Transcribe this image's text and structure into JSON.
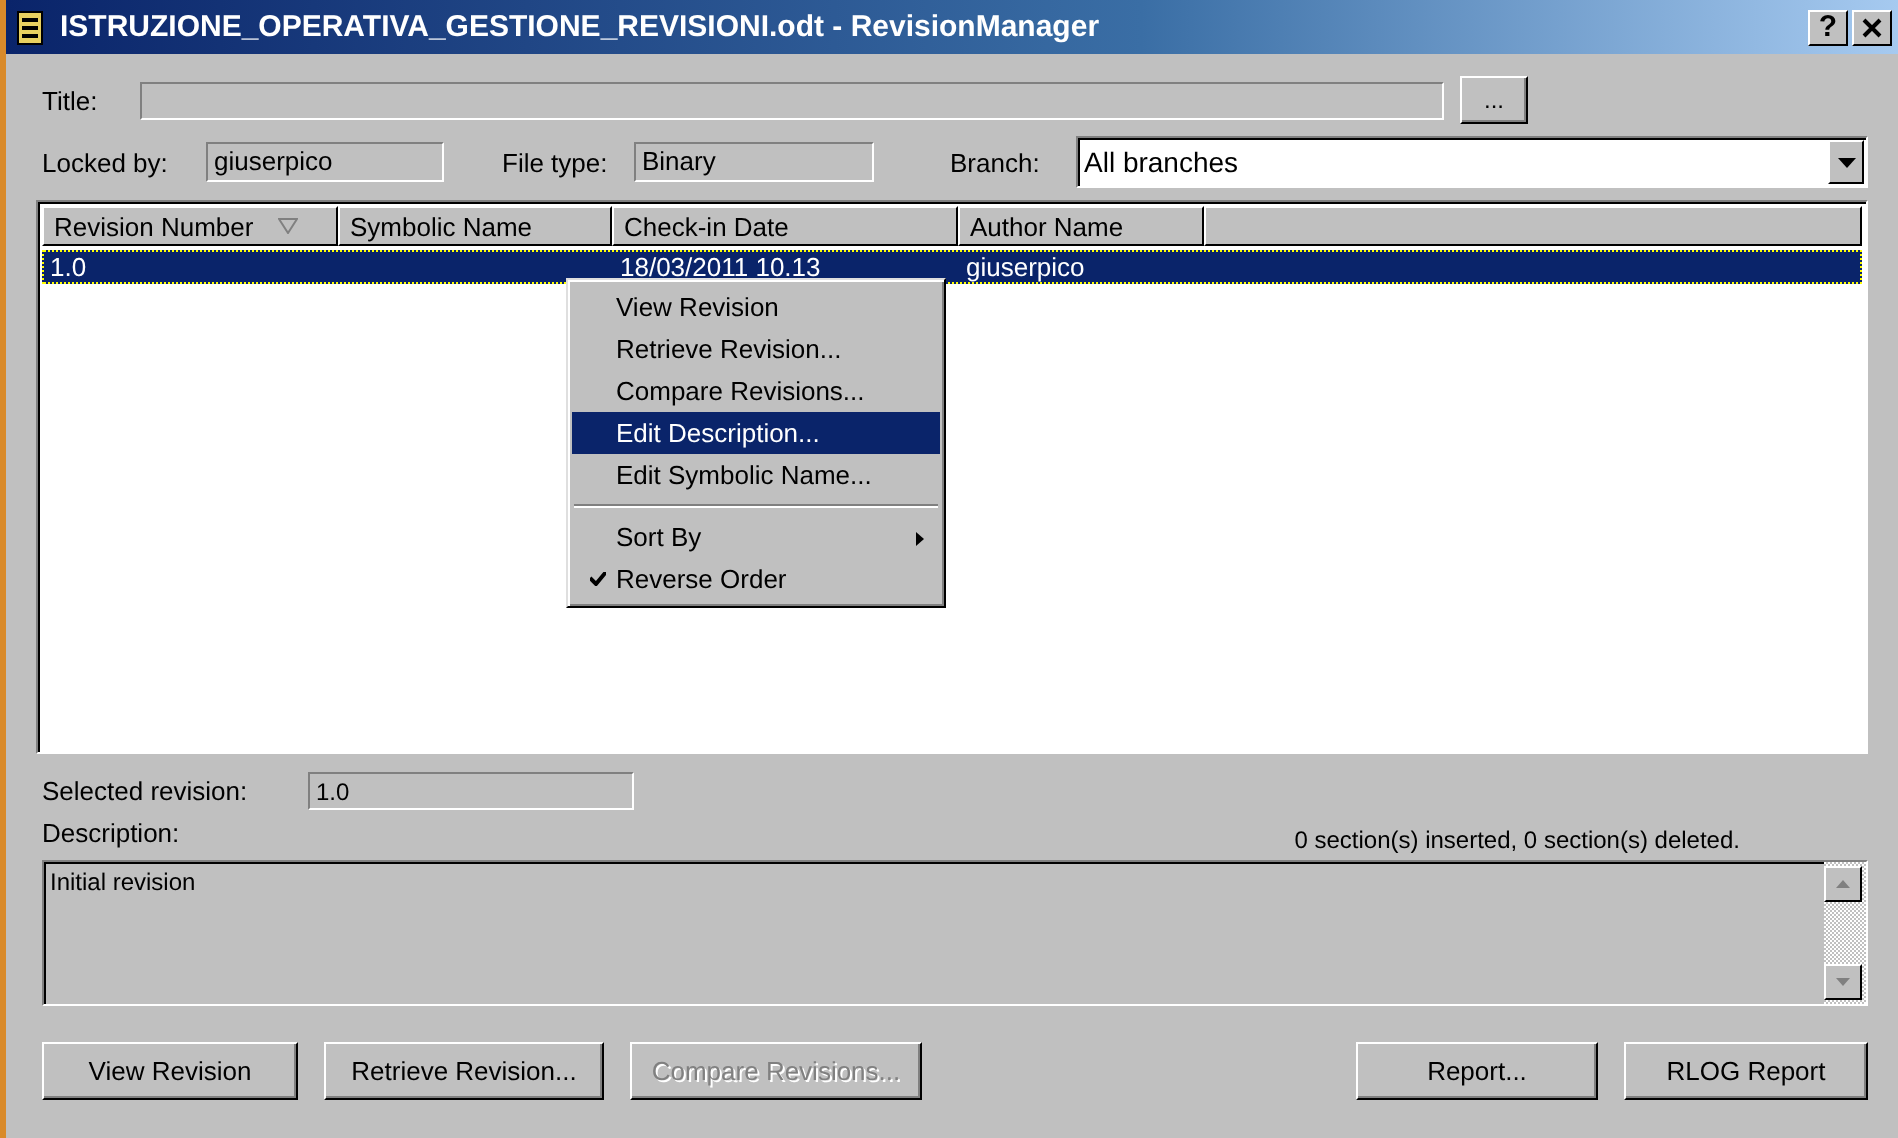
{
  "window": {
    "title": "ISTRUZIONE_OPERATIVA_GESTIONE_REVISIONI.odt - RevisionManager",
    "help_button": "?"
  },
  "title_field": {
    "label": "Title:",
    "browse_button": "..."
  },
  "locked_by": {
    "label": "Locked by:",
    "value": "giuserpico"
  },
  "file_type": {
    "label": "File type:",
    "value": "Binary"
  },
  "branch": {
    "label": "Branch:",
    "value": "All branches"
  },
  "revisions": {
    "columns": [
      {
        "label": "Revision Number",
        "sorted": true
      },
      {
        "label": "Symbolic Name",
        "sorted": false
      },
      {
        "label": "Check-in Date",
        "sorted": false
      },
      {
        "label": "Author Name",
        "sorted": false
      }
    ],
    "rows": [
      {
        "cells": [
          "1.0",
          "",
          "18/03/2011 10.13",
          "giuserpico"
        ],
        "selected": true
      }
    ]
  },
  "context_menu": [
    {
      "kind": "item",
      "label": "View Revision",
      "selected": false,
      "checked": false,
      "submenu": false
    },
    {
      "kind": "item",
      "label": "Retrieve Revision...",
      "selected": false,
      "checked": false,
      "submenu": false
    },
    {
      "kind": "item",
      "label": "Compare Revisions...",
      "selected": false,
      "checked": false,
      "submenu": false
    },
    {
      "kind": "item",
      "label": "Edit Description...",
      "selected": true,
      "checked": false,
      "submenu": false
    },
    {
      "kind": "item",
      "label": "Edit Symbolic Name...",
      "selected": false,
      "checked": false,
      "submenu": false
    },
    {
      "kind": "separator"
    },
    {
      "kind": "item",
      "label": "Sort By",
      "selected": false,
      "checked": false,
      "submenu": true
    },
    {
      "kind": "item",
      "label": "Reverse Order",
      "selected": false,
      "checked": true,
      "submenu": false
    }
  ],
  "selected_revision": {
    "label": "Selected revision:",
    "value": "1.0"
  },
  "description": {
    "label": "Description:",
    "value": "Initial revision",
    "stats": "0 section(s) inserted, 0 section(s) deleted."
  },
  "buttons": [
    {
      "label": "View Revision",
      "disabled": false
    },
    {
      "label": "Retrieve Revision...",
      "disabled": false
    },
    {
      "label": "Compare Revisions...",
      "disabled": true
    }
  ],
  "report_buttons": [
    {
      "label": "Report...",
      "disabled": false
    },
    {
      "label": "RLOG Report",
      "disabled": false
    }
  ]
}
